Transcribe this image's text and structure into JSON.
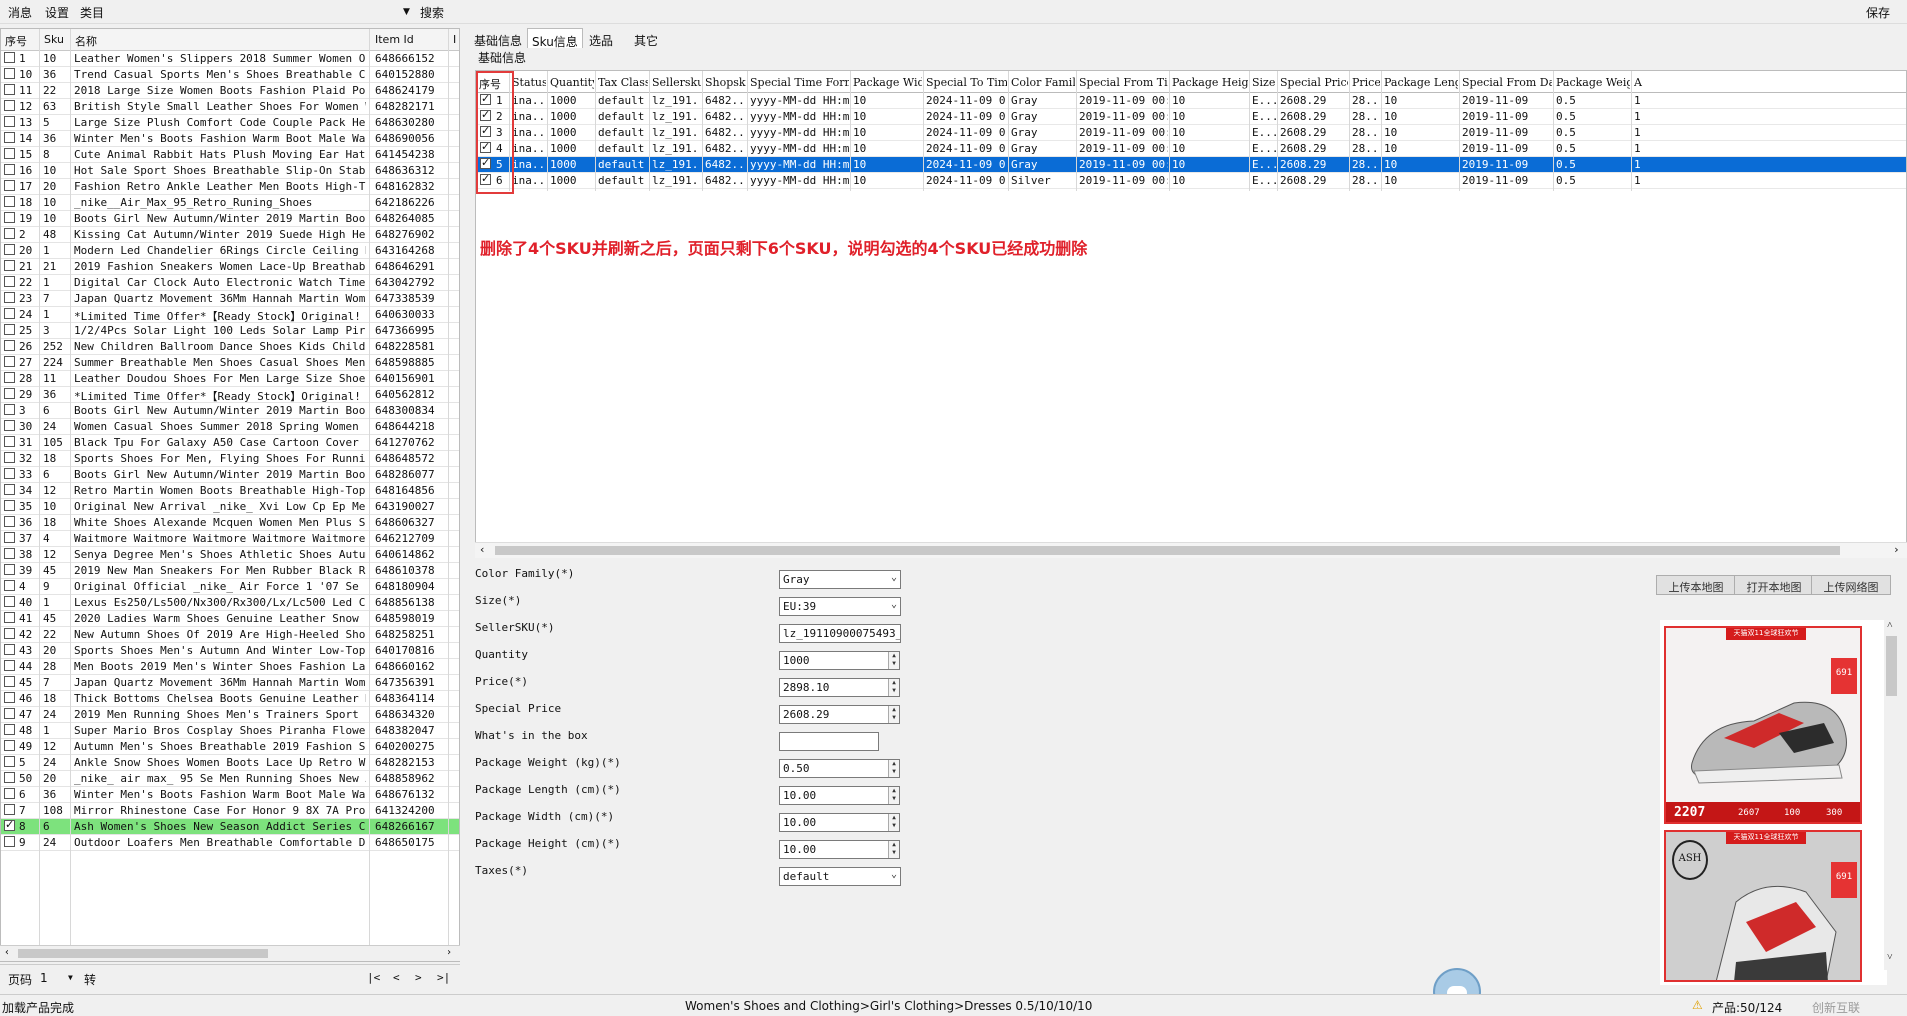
{
  "menu": {
    "items": [
      "消息",
      "设置",
      "类目"
    ],
    "search_label": "搜索",
    "save_label": "保存"
  },
  "left_table": {
    "headers": [
      "序号",
      "Sku",
      "名称",
      "Item Id"
    ],
    "rows": [
      {
        "idx": "1",
        "sku": "10",
        "name": "Leather Women's Slippers 2018 Summer Women Op...",
        "item_id": "648666152",
        "checked": false
      },
      {
        "idx": "10",
        "sku": "36",
        "name": "Trend Casual Sports Men's Shoes Breathable Co...",
        "item_id": "640152880",
        "checked": false
      },
      {
        "idx": "11",
        "sku": "22",
        "name": "2018 Large Size Women Boots Fashion Plaid Poi...",
        "item_id": "648624179",
        "checked": false
      },
      {
        "idx": "12",
        "sku": "63",
        "name": "British Style Small Leather Shoes For Women W...",
        "item_id": "648282171",
        "checked": false
      },
      {
        "idx": "13",
        "sku": "5",
        "name": "Large Size Plush Comfort Code Couple Pack Hee...",
        "item_id": "648630280",
        "checked": false
      },
      {
        "idx": "14",
        "sku": "36",
        "name": "Winter Men's Boots Fashion Warm Boot Male Wat...",
        "item_id": "648690056",
        "checked": false
      },
      {
        "idx": "15",
        "sku": "8",
        "name": "Cute Animal Rabbit Hats Plush Moving Ear Hat ...",
        "item_id": "641454238",
        "checked": false
      },
      {
        "idx": "16",
        "sku": "10",
        "name": "Hot Sale Sport Shoes Breathable Slip-On Stabi...",
        "item_id": "648636312",
        "checked": false
      },
      {
        "idx": "17",
        "sku": "20",
        "name": "Fashion Retro Ankle Leather Men Boots High-To...",
        "item_id": "648162832",
        "checked": false
      },
      {
        "idx": "18",
        "sku": "10",
        "name": "_nike__Air_Max_95_Retro_Runing_Shoes",
        "item_id": "642186226",
        "checked": false
      },
      {
        "idx": "19",
        "sku": "10",
        "name": "Boots Girl New Autumn/Winter 2019 Martin Boot...",
        "item_id": "648264085",
        "checked": false
      },
      {
        "idx": "2",
        "sku": "48",
        "name": "Kissing Cat Autumn/Winter 2019 Suede High Hee...",
        "item_id": "648276902",
        "checked": false
      },
      {
        "idx": "20",
        "sku": "1",
        "name": "Modern Led Chandelier 6Rings Circle Ceiling M...",
        "item_id": "643164268",
        "checked": false
      },
      {
        "idx": "21",
        "sku": "21",
        "name": "2019 Fashion Sneakers Women Lace-Up Breathabl...",
        "item_id": "648646291",
        "checked": false
      },
      {
        "idx": "22",
        "sku": "1",
        "name": "Digital Car Clock Auto Electronic Watch Timet...",
        "item_id": "643042792",
        "checked": false
      },
      {
        "idx": "23",
        "sku": "7",
        "name": "Japan Quartz Movement 36Mm Hannah Martin Wome...",
        "item_id": "647338539",
        "checked": false
      },
      {
        "idx": "24",
        "sku": "1",
        "name": "*Limited Time Offer*【Ready Stock】Original! ...",
        "item_id": "640630033",
        "checked": false
      },
      {
        "idx": "25",
        "sku": "3",
        "name": "1/2/4Pcs Solar Light 100 Leds Solar Lamp Pir ...",
        "item_id": "647366995",
        "checked": false
      },
      {
        "idx": "26",
        "sku": "252",
        "name": "New Children Ballroom Dance Shoes Kids Child ...",
        "item_id": "648228581",
        "checked": false
      },
      {
        "idx": "27",
        "sku": "224",
        "name": "Summer Breathable Men Shoes Casual Shoes Men ...",
        "item_id": "648598885",
        "checked": false
      },
      {
        "idx": "28",
        "sku": "11",
        "name": "Leather Doudou Shoes For Men Large Size Shoes...",
        "item_id": "640156901",
        "checked": false
      },
      {
        "idx": "29",
        "sku": "36",
        "name": "*Limited Time Offer*【Ready Stock】Original! ...",
        "item_id": "640562812",
        "checked": false
      },
      {
        "idx": "3",
        "sku": "6",
        "name": "Boots Girl New Autumn/Winter 2019 Martin Boot...",
        "item_id": "648300834",
        "checked": false
      },
      {
        "idx": "30",
        "sku": "24",
        "name": "Women Casual Shoes Summer 2018 Spring Women S...",
        "item_id": "648644218",
        "checked": false
      },
      {
        "idx": "31",
        "sku": "105",
        "name": "Black Tpu For Galaxy A50 Case Cartoon Cover C...",
        "item_id": "641270762",
        "checked": false
      },
      {
        "idx": "32",
        "sku": "18",
        "name": "Sports Shoes For Men, Flying Shoes For Runnin...",
        "item_id": "648648572",
        "checked": false
      },
      {
        "idx": "33",
        "sku": "6",
        "name": "Boots Girl New Autumn/Winter 2019 Martin Boot...",
        "item_id": "648286077",
        "checked": false
      },
      {
        "idx": "34",
        "sku": "12",
        "name": "Retro Martin Women Boots Breathable High-Top ...",
        "item_id": "648164856",
        "checked": false
      },
      {
        "idx": "35",
        "sku": "10",
        "name": "Original New Arrival _nike_ Xvi Low Cp Ep Men...",
        "item_id": "643190027",
        "checked": false
      },
      {
        "idx": "36",
        "sku": "18",
        "name": "White Shoes Alexande Mcquen Women Men Plus Si...",
        "item_id": "648606327",
        "checked": false
      },
      {
        "idx": "37",
        "sku": "4",
        "name": "Waitmore Waitmore Waitmore Waitmore Waitmore ...",
        "item_id": "646212709",
        "checked": false
      },
      {
        "idx": "38",
        "sku": "12",
        "name": "Senya Degree Men's Shoes Athletic Shoes Autum...",
        "item_id": "640614862",
        "checked": false
      },
      {
        "idx": "39",
        "sku": "45",
        "name": "2019 New Man Sneakers For Men Rubber Black Ru...",
        "item_id": "648610378",
        "checked": false
      },
      {
        "idx": "4",
        "sku": "9",
        "name": "Original Official _nike_ Air Force 1 '07 Se P...",
        "item_id": "648180904",
        "checked": false
      },
      {
        "idx": "40",
        "sku": "1",
        "name": "Lexus Es250/Ls500/Nx300/Rx300/Lx/Lc500 Led Ca...",
        "item_id": "648856138",
        "checked": false
      },
      {
        "idx": "41",
        "sku": "45",
        "name": "2020 Ladies Warm Shoes Genuine Leather Snow B...",
        "item_id": "648598019",
        "checked": false
      },
      {
        "idx": "42",
        "sku": "22",
        "name": "New Autumn Shoes Of 2019 Are High-Heeled Shoe...",
        "item_id": "648258251",
        "checked": false
      },
      {
        "idx": "43",
        "sku": "20",
        "name": "Sports Shoes Men's Autumn And Winter Low-Top ...",
        "item_id": "640170816",
        "checked": false
      },
      {
        "idx": "44",
        "sku": "28",
        "name": "Men Boots 2019 Men's Winter Shoes Fashion Lac...",
        "item_id": "648660162",
        "checked": false
      },
      {
        "idx": "45",
        "sku": "7",
        "name": "Japan Quartz Movement 36Mm Hannah Martin Wome...",
        "item_id": "647356391",
        "checked": false
      },
      {
        "idx": "46",
        "sku": "18",
        "name": "Thick Bottoms Chelsea Boots Genuine Leather M...",
        "item_id": "648364114",
        "checked": false
      },
      {
        "idx": "47",
        "sku": "24",
        "name": "2019 Men Running Shoes Men's Trainers Sport S...",
        "item_id": "648634320",
        "checked": false
      },
      {
        "idx": "48",
        "sku": "1",
        "name": "Super Mario Bros Cosplay Shoes Piranha Flower...",
        "item_id": "648382047",
        "checked": false
      },
      {
        "idx": "49",
        "sku": "12",
        "name": "Autumn Men's Shoes Breathable 2019 Fashion Sh...",
        "item_id": "640200275",
        "checked": false
      },
      {
        "idx": "5",
        "sku": "24",
        "name": "Ankle Snow Shoes Women Boots Lace Up Retro Wa...",
        "item_id": "648282153",
        "checked": false
      },
      {
        "idx": "50",
        "sku": "20",
        "name": "_nike_ air max_ 95 Se Men Running Shoes New A...",
        "item_id": "648858962",
        "checked": false
      },
      {
        "idx": "6",
        "sku": "36",
        "name": "Winter Men's Boots Fashion Warm Boot Male Wat...",
        "item_id": "648676132",
        "checked": false
      },
      {
        "idx": "7",
        "sku": "108",
        "name": "Mirror Rhinestone Case For Honor 9 8X 7A Pro ...",
        "item_id": "641324200",
        "checked": false
      },
      {
        "idx": "8",
        "sku": "6",
        "name": "Ash Women's Shoes New Season Addict Series Co...",
        "item_id": "648266167",
        "checked": true
      },
      {
        "idx": "9",
        "sku": "24",
        "name": "Outdoor Loafers Men Breathable Comfortable Dr...",
        "item_id": "648650175",
        "checked": false
      }
    ]
  },
  "pager": {
    "label": "页码",
    "value": "1",
    "go": "转",
    "nav": [
      "|<",
      "<",
      ">",
      ">|"
    ]
  },
  "tabs": [
    "基础信息",
    "Sku信息",
    "选品",
    "其它"
  ],
  "subtab": "基础信息",
  "sku_table": {
    "headers": [
      "序号",
      "Status",
      "Quantity",
      "Tax Class",
      "Sellersku",
      "Shopsku",
      "Special Time Format",
      "Package Width",
      "Special To Time",
      "Color Family",
      "Special From Time",
      "Package Height",
      "Size",
      "Special Price",
      "Price",
      "Package Length",
      "Special From Date",
      "Package Weight",
      "A"
    ],
    "rows": [
      [
        "1",
        "ina...",
        "1000",
        "default",
        "lz_191...",
        "6482...",
        "yyyy-MM-dd HH:mm",
        "10",
        "2024-11-09 0...",
        "Gray",
        "2019-11-09 00:07",
        "10",
        "E...",
        "2608.29",
        "28...",
        "10",
        "2019-11-09",
        "0.5",
        "1"
      ],
      [
        "2",
        "ina...",
        "1000",
        "default",
        "lz_191...",
        "6482...",
        "yyyy-MM-dd HH:mm",
        "10",
        "2024-11-09 0...",
        "Gray",
        "2019-11-09 00:07",
        "10",
        "E...",
        "2608.29",
        "28...",
        "10",
        "2019-11-09",
        "0.5",
        "1"
      ],
      [
        "3",
        "ina...",
        "1000",
        "default",
        "lz_191...",
        "6482...",
        "yyyy-MM-dd HH:mm",
        "10",
        "2024-11-09 0...",
        "Gray",
        "2019-11-09 00:07",
        "10",
        "E...",
        "2608.29",
        "28...",
        "10",
        "2019-11-09",
        "0.5",
        "1"
      ],
      [
        "4",
        "ina...",
        "1000",
        "default",
        "lz_191...",
        "6482...",
        "yyyy-MM-dd HH:mm",
        "10",
        "2024-11-09 0...",
        "Gray",
        "2019-11-09 00:07",
        "10",
        "E...",
        "2608.29",
        "28...",
        "10",
        "2019-11-09",
        "0.5",
        "1"
      ],
      [
        "5",
        "ina...",
        "1000",
        "default",
        "lz_191...",
        "6482...",
        "yyyy-MM-dd HH:mm",
        "10",
        "2024-11-09 0...",
        "Gray",
        "2019-11-09 00:07",
        "10",
        "E...",
        "2608.29",
        "28...",
        "10",
        "2019-11-09",
        "0.5",
        "1"
      ],
      [
        "6",
        "ina...",
        "1000",
        "default",
        "lz_191...",
        "6482...",
        "yyyy-MM-dd HH:mm",
        "10",
        "2024-11-09 0...",
        "Silver",
        "2019-11-09 00:07",
        "10",
        "E...",
        "2608.29",
        "28...",
        "10",
        "2019-11-09",
        "0.5",
        "1"
      ]
    ],
    "selected_row": 4
  },
  "annotation": "删除了4个SKU并刷新之后，页面只剩下6个SKU，说明勾选的4个SKU已经成功删除",
  "form": {
    "fields": [
      {
        "label": "Color Family(*)",
        "value": "Gray",
        "kind": "combo"
      },
      {
        "label": "Size(*)",
        "value": "EU:39",
        "kind": "combo"
      },
      {
        "label": "SellerSKU(*)",
        "value": "lz_19110900075493_5",
        "kind": "text"
      },
      {
        "label": "Quantity",
        "value": "1000",
        "kind": "spin"
      },
      {
        "label": "Price(*)",
        "value": "2898.10",
        "kind": "spin"
      },
      {
        "label": "Special Price",
        "value": "2608.29",
        "kind": "spin"
      },
      {
        "label": "What's in the box",
        "value": "",
        "kind": "text"
      },
      {
        "label": "Package Weight (kg)(*)",
        "value": "0.50",
        "kind": "spin"
      },
      {
        "label": "Package Length (cm)(*)",
        "value": "10.00",
        "kind": "spin"
      },
      {
        "label": "Package Width (cm)(*)",
        "value": "10.00",
        "kind": "spin"
      },
      {
        "label": "Package Height (cm)(*)",
        "value": "10.00",
        "kind": "spin"
      },
      {
        "label": "Taxes(*)",
        "value": "default",
        "kind": "combo"
      }
    ]
  },
  "image_buttons": [
    "上传本地图",
    "打开本地图",
    "上传网络图"
  ],
  "product_images": [
    {
      "banner": "天猫双11全球狂欢节",
      "badge": "691",
      "price": "2207",
      "stats": [
        "2607",
        "100",
        "300"
      ]
    },
    {
      "banner": "天猫双11全球狂欢节",
      "badge": "691",
      "logo": "ASH"
    }
  ],
  "status": {
    "left": "加载产品完成",
    "center": "Women's Shoes and Clothing>Girl's Clothing>Dresses  0.5/10/10/10",
    "right": "产品:50/124",
    "watermark": "创新互联"
  },
  "colors": {
    "accent": "#0a6cd6",
    "annotation": "#e0202a",
    "highlight_row": "#7de27d",
    "box": "#e23b3b"
  }
}
